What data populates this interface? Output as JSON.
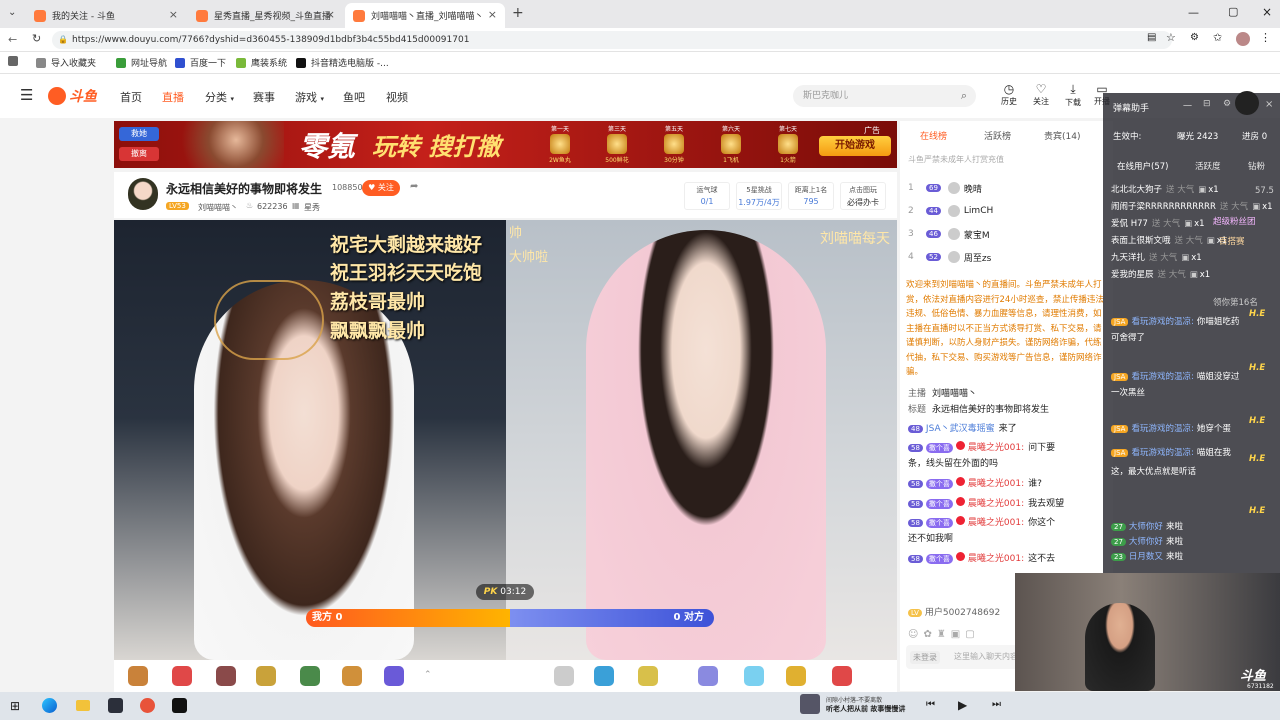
{
  "tabs": [
    {
      "title": "我的关注 - 斗鱼"
    },
    {
      "title": "星秀直播_星秀视频_斗鱼直播"
    },
    {
      "title": "刘喵喵喵丶直播_刘喵喵喵丶星"
    }
  ],
  "address": {
    "url": "https://www.douyu.com/7766?dyshid=d360455-138909d1bdbf3b4c55bd415d00091701"
  },
  "bookmarks": [
    "导入收藏夹",
    "网址导航",
    "百度一下",
    "鹰装系统",
    "抖音精选电脑版 -..."
  ],
  "site": {
    "logo": "斗鱼",
    "nav": [
      "首页",
      "直播",
      "分类",
      "赛事",
      "游戏",
      "鱼吧",
      "视频"
    ],
    "search_placeholder": "斯巴克咖儿",
    "header_icons": [
      "历史",
      "关注",
      "下载",
      "开播"
    ]
  },
  "banner": {
    "left_btns": [
      "救她",
      "撤离"
    ],
    "title": "零氪",
    "slogan": "玩转 搜打撤",
    "days": [
      "第一天",
      "第三天",
      "第五天",
      "第六天",
      "第七天"
    ],
    "rewards": [
      "2W鱼丸",
      "500鲜花",
      "30分钟",
      "1飞机",
      "1火箭"
    ],
    "ad": "广告",
    "cta": "开始游戏"
  },
  "streamer": {
    "title": "永远相信美好的事物即将发生",
    "followers": "108850",
    "follow_label": "关注",
    "level": "LV53",
    "name": "刘喵喵喵丶",
    "heat": "622236",
    "category": "星秀",
    "stats": [
      {
        "label": "运气球",
        "value": "0/1"
      },
      {
        "label": "5星挑战",
        "value": "1.97万/4万"
      },
      {
        "label": "距离上1名",
        "value": "795"
      },
      {
        "label": "点击图玩",
        "value": "必得办卡"
      }
    ]
  },
  "video": {
    "captions": [
      "祝宅大剩越来越好",
      "祝王羽衫天天吃饱",
      "荔枝哥最帅",
      "飘飘飘最帅"
    ],
    "right_top": "刘喵喵每天",
    "mid_top": "帅",
    "mid_top2": "大帅啦",
    "pk_label": "PK",
    "pk_time": "03:12",
    "our_side": "我方 0",
    "their_side": "0 对方"
  },
  "rank": {
    "tabs": [
      "在线榜",
      "活跃榜",
      "贵宾(14)"
    ],
    "notice": "斗鱼严禁未成年人打赏充值",
    "items": [
      {
        "rank": "1",
        "level": "69",
        "name": "晚晴"
      },
      {
        "rank": "2",
        "level": "44",
        "name": "LimCH"
      },
      {
        "rank": "3",
        "level": "46",
        "name": "蒙宝M"
      },
      {
        "rank": "4",
        "level": "52",
        "name": "周至zs"
      }
    ]
  },
  "announce": "欢迎来到刘喵喵喵丶的直播间。斗鱼严禁未成年人打赏，依法对直播内容进行24小时巡查，禁止传播违法违规、低俗色情、暴力血腥等信息，请理性消费，如主播在直播时以不正当方式诱导打赏、私下交易，请谨慎判断，以防人身财产损失。谨防网络诈骗，代练代抽，私下交易、购买游戏等广告信息，谨防网络诈骗。",
  "host": {
    "host_label": "主播",
    "host_name": "刘喵喵喵丶",
    "title_label": "标题",
    "title": "永远相信美好的事物即将发生"
  },
  "chat": [
    {
      "level": "48",
      "user": "JSA丶武汉毒瑶蜜",
      "text": "来了"
    },
    {
      "level": "58",
      "badge": "撒个喜",
      "user": "晨曦之光001:",
      "text": "问下要"
    },
    {
      "level": "",
      "badge": "",
      "user": "",
      "text": "条，线头留在外面的吗"
    },
    {
      "level": "58",
      "badge": "撒个喜",
      "user": "晨曦之光001:",
      "text": "谁?"
    },
    {
      "level": "58",
      "badge": "撒个喜",
      "user": "晨曦之光001:",
      "text": "我去观望"
    },
    {
      "level": "58",
      "badge": "撒个喜",
      "user": "晨曦之光001:",
      "text": "你这个"
    },
    {
      "level": "",
      "badge": "",
      "user": "",
      "text": "还不如我啊"
    },
    {
      "level": "58",
      "badge": "撒个喜",
      "user": "晨曦之光001:",
      "text": "这不去"
    }
  ],
  "chat_user": "用户5002748692",
  "chat_input_placeholder": "这里输入聊天内容",
  "chat_unlogin": "未登录",
  "overlay": {
    "title": "弹幕助手",
    "status_label": "生效中:",
    "exposure": "曝光 2423",
    "enter": "进房 0",
    "tabs": [
      "在线用户(57)",
      "活跃度",
      "钻粉"
    ],
    "users": [
      {
        "name": "北北北大狗子",
        "note": "送 大气",
        "count": "x1"
      },
      {
        "name": "闹闹子梁RRRRRRRRRRRR",
        "note": "送 大气",
        "count": "x1"
      },
      {
        "name": "爱侃 H77",
        "note": "送 大气",
        "count": "x1"
      },
      {
        "name": "表面上很斯文哦",
        "note": "送 大气",
        "count": "x1"
      },
      {
        "name": "九天洋扎",
        "note": "送 大气",
        "count": "x1"
      },
      {
        "name": "爱我的星辰",
        "note": "送 大气",
        "count": "x1"
      }
    ],
    "side_labels": [
      "57.5",
      "超级粉丝团",
      "百搭赛",
      "领你第16名"
    ],
    "messages": [
      {
        "user": "看玩游戏的温凉:",
        "text": "你喵姐吃药"
      },
      {
        "user": "",
        "text": "可舍得了"
      },
      {
        "user": "看玩游戏的温凉:",
        "text": "喵姐没穿过"
      },
      {
        "user": "",
        "text": "一次黑丝"
      },
      {
        "user": "看玩游戏的温凉:",
        "text": "她穿个蛋"
      },
      {
        "user": "看玩游戏的温凉:",
        "text": "喵姐在我"
      },
      {
        "user": "",
        "text": "这，最大优点就是听话"
      },
      {
        "user": "大师你好",
        "text": "来啦"
      },
      {
        "user": "大师你好",
        "text": "来啦"
      },
      {
        "user": "日月数又",
        "text": "来啦"
      }
    ],
    "tag_he": "H.E",
    "level_badge": "JSA",
    "counts": [
      "27",
      "27",
      "23"
    ]
  },
  "cam": {
    "logo": "斗鱼",
    "id": "6731182"
  },
  "music": {
    "line1": "间隙小村落-不要离散",
    "line2": "听老人把从前 故事慢慢讲"
  },
  "colors": {
    "brand": "#ff5d23",
    "accent_blue": "#4a7bd8",
    "pk_red": "#ff5a1f",
    "pk_blue": "#4b6ae0"
  }
}
